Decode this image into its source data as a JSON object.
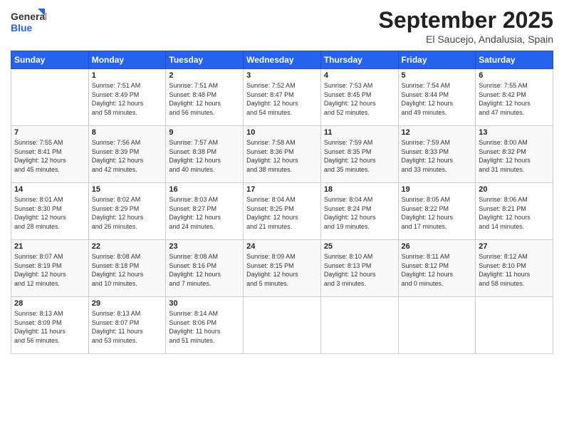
{
  "header": {
    "logo_general": "General",
    "logo_blue": "Blue",
    "month_title": "September 2025",
    "location": "El Saucejo, Andalusia, Spain"
  },
  "weekdays": [
    "Sunday",
    "Monday",
    "Tuesday",
    "Wednesday",
    "Thursday",
    "Friday",
    "Saturday"
  ],
  "weeks": [
    [
      {
        "day": "",
        "info": ""
      },
      {
        "day": "1",
        "info": "Sunrise: 7:51 AM\nSunset: 8:49 PM\nDaylight: 12 hours\nand 58 minutes."
      },
      {
        "day": "2",
        "info": "Sunrise: 7:51 AM\nSunset: 8:48 PM\nDaylight: 12 hours\nand 56 minutes."
      },
      {
        "day": "3",
        "info": "Sunrise: 7:52 AM\nSunset: 8:47 PM\nDaylight: 12 hours\nand 54 minutes."
      },
      {
        "day": "4",
        "info": "Sunrise: 7:53 AM\nSunset: 8:45 PM\nDaylight: 12 hours\nand 52 minutes."
      },
      {
        "day": "5",
        "info": "Sunrise: 7:54 AM\nSunset: 8:44 PM\nDaylight: 12 hours\nand 49 minutes."
      },
      {
        "day": "6",
        "info": "Sunrise: 7:55 AM\nSunset: 8:42 PM\nDaylight: 12 hours\nand 47 minutes."
      }
    ],
    [
      {
        "day": "7",
        "info": "Sunrise: 7:55 AM\nSunset: 8:41 PM\nDaylight: 12 hours\nand 45 minutes."
      },
      {
        "day": "8",
        "info": "Sunrise: 7:56 AM\nSunset: 8:39 PM\nDaylight: 12 hours\nand 42 minutes."
      },
      {
        "day": "9",
        "info": "Sunrise: 7:57 AM\nSunset: 8:38 PM\nDaylight: 12 hours\nand 40 minutes."
      },
      {
        "day": "10",
        "info": "Sunrise: 7:58 AM\nSunset: 8:36 PM\nDaylight: 12 hours\nand 38 minutes."
      },
      {
        "day": "11",
        "info": "Sunrise: 7:59 AM\nSunset: 8:35 PM\nDaylight: 12 hours\nand 35 minutes."
      },
      {
        "day": "12",
        "info": "Sunrise: 7:59 AM\nSunset: 8:33 PM\nDaylight: 12 hours\nand 33 minutes."
      },
      {
        "day": "13",
        "info": "Sunrise: 8:00 AM\nSunset: 8:32 PM\nDaylight: 12 hours\nand 31 minutes."
      }
    ],
    [
      {
        "day": "14",
        "info": "Sunrise: 8:01 AM\nSunset: 8:30 PM\nDaylight: 12 hours\nand 28 minutes."
      },
      {
        "day": "15",
        "info": "Sunrise: 8:02 AM\nSunset: 8:29 PM\nDaylight: 12 hours\nand 26 minutes."
      },
      {
        "day": "16",
        "info": "Sunrise: 8:03 AM\nSunset: 8:27 PM\nDaylight: 12 hours\nand 24 minutes."
      },
      {
        "day": "17",
        "info": "Sunrise: 8:04 AM\nSunset: 8:25 PM\nDaylight: 12 hours\nand 21 minutes."
      },
      {
        "day": "18",
        "info": "Sunrise: 8:04 AM\nSunset: 8:24 PM\nDaylight: 12 hours\nand 19 minutes."
      },
      {
        "day": "19",
        "info": "Sunrise: 8:05 AM\nSunset: 8:22 PM\nDaylight: 12 hours\nand 17 minutes."
      },
      {
        "day": "20",
        "info": "Sunrise: 8:06 AM\nSunset: 8:21 PM\nDaylight: 12 hours\nand 14 minutes."
      }
    ],
    [
      {
        "day": "21",
        "info": "Sunrise: 8:07 AM\nSunset: 8:19 PM\nDaylight: 12 hours\nand 12 minutes."
      },
      {
        "day": "22",
        "info": "Sunrise: 8:08 AM\nSunset: 8:18 PM\nDaylight: 12 hours\nand 10 minutes."
      },
      {
        "day": "23",
        "info": "Sunrise: 8:08 AM\nSunset: 8:16 PM\nDaylight: 12 hours\nand 7 minutes."
      },
      {
        "day": "24",
        "info": "Sunrise: 8:09 AM\nSunset: 8:15 PM\nDaylight: 12 hours\nand 5 minutes."
      },
      {
        "day": "25",
        "info": "Sunrise: 8:10 AM\nSunset: 8:13 PM\nDaylight: 12 hours\nand 3 minutes."
      },
      {
        "day": "26",
        "info": "Sunrise: 8:11 AM\nSunset: 8:12 PM\nDaylight: 12 hours\nand 0 minutes."
      },
      {
        "day": "27",
        "info": "Sunrise: 8:12 AM\nSunset: 8:10 PM\nDaylight: 11 hours\nand 58 minutes."
      }
    ],
    [
      {
        "day": "28",
        "info": "Sunrise: 8:13 AM\nSunset: 8:09 PM\nDaylight: 11 hours\nand 56 minutes."
      },
      {
        "day": "29",
        "info": "Sunrise: 8:13 AM\nSunset: 8:07 PM\nDaylight: 11 hours\nand 53 minutes."
      },
      {
        "day": "30",
        "info": "Sunrise: 8:14 AM\nSunset: 8:06 PM\nDaylight: 11 hours\nand 51 minutes."
      },
      {
        "day": "",
        "info": ""
      },
      {
        "day": "",
        "info": ""
      },
      {
        "day": "",
        "info": ""
      },
      {
        "day": "",
        "info": ""
      }
    ]
  ]
}
